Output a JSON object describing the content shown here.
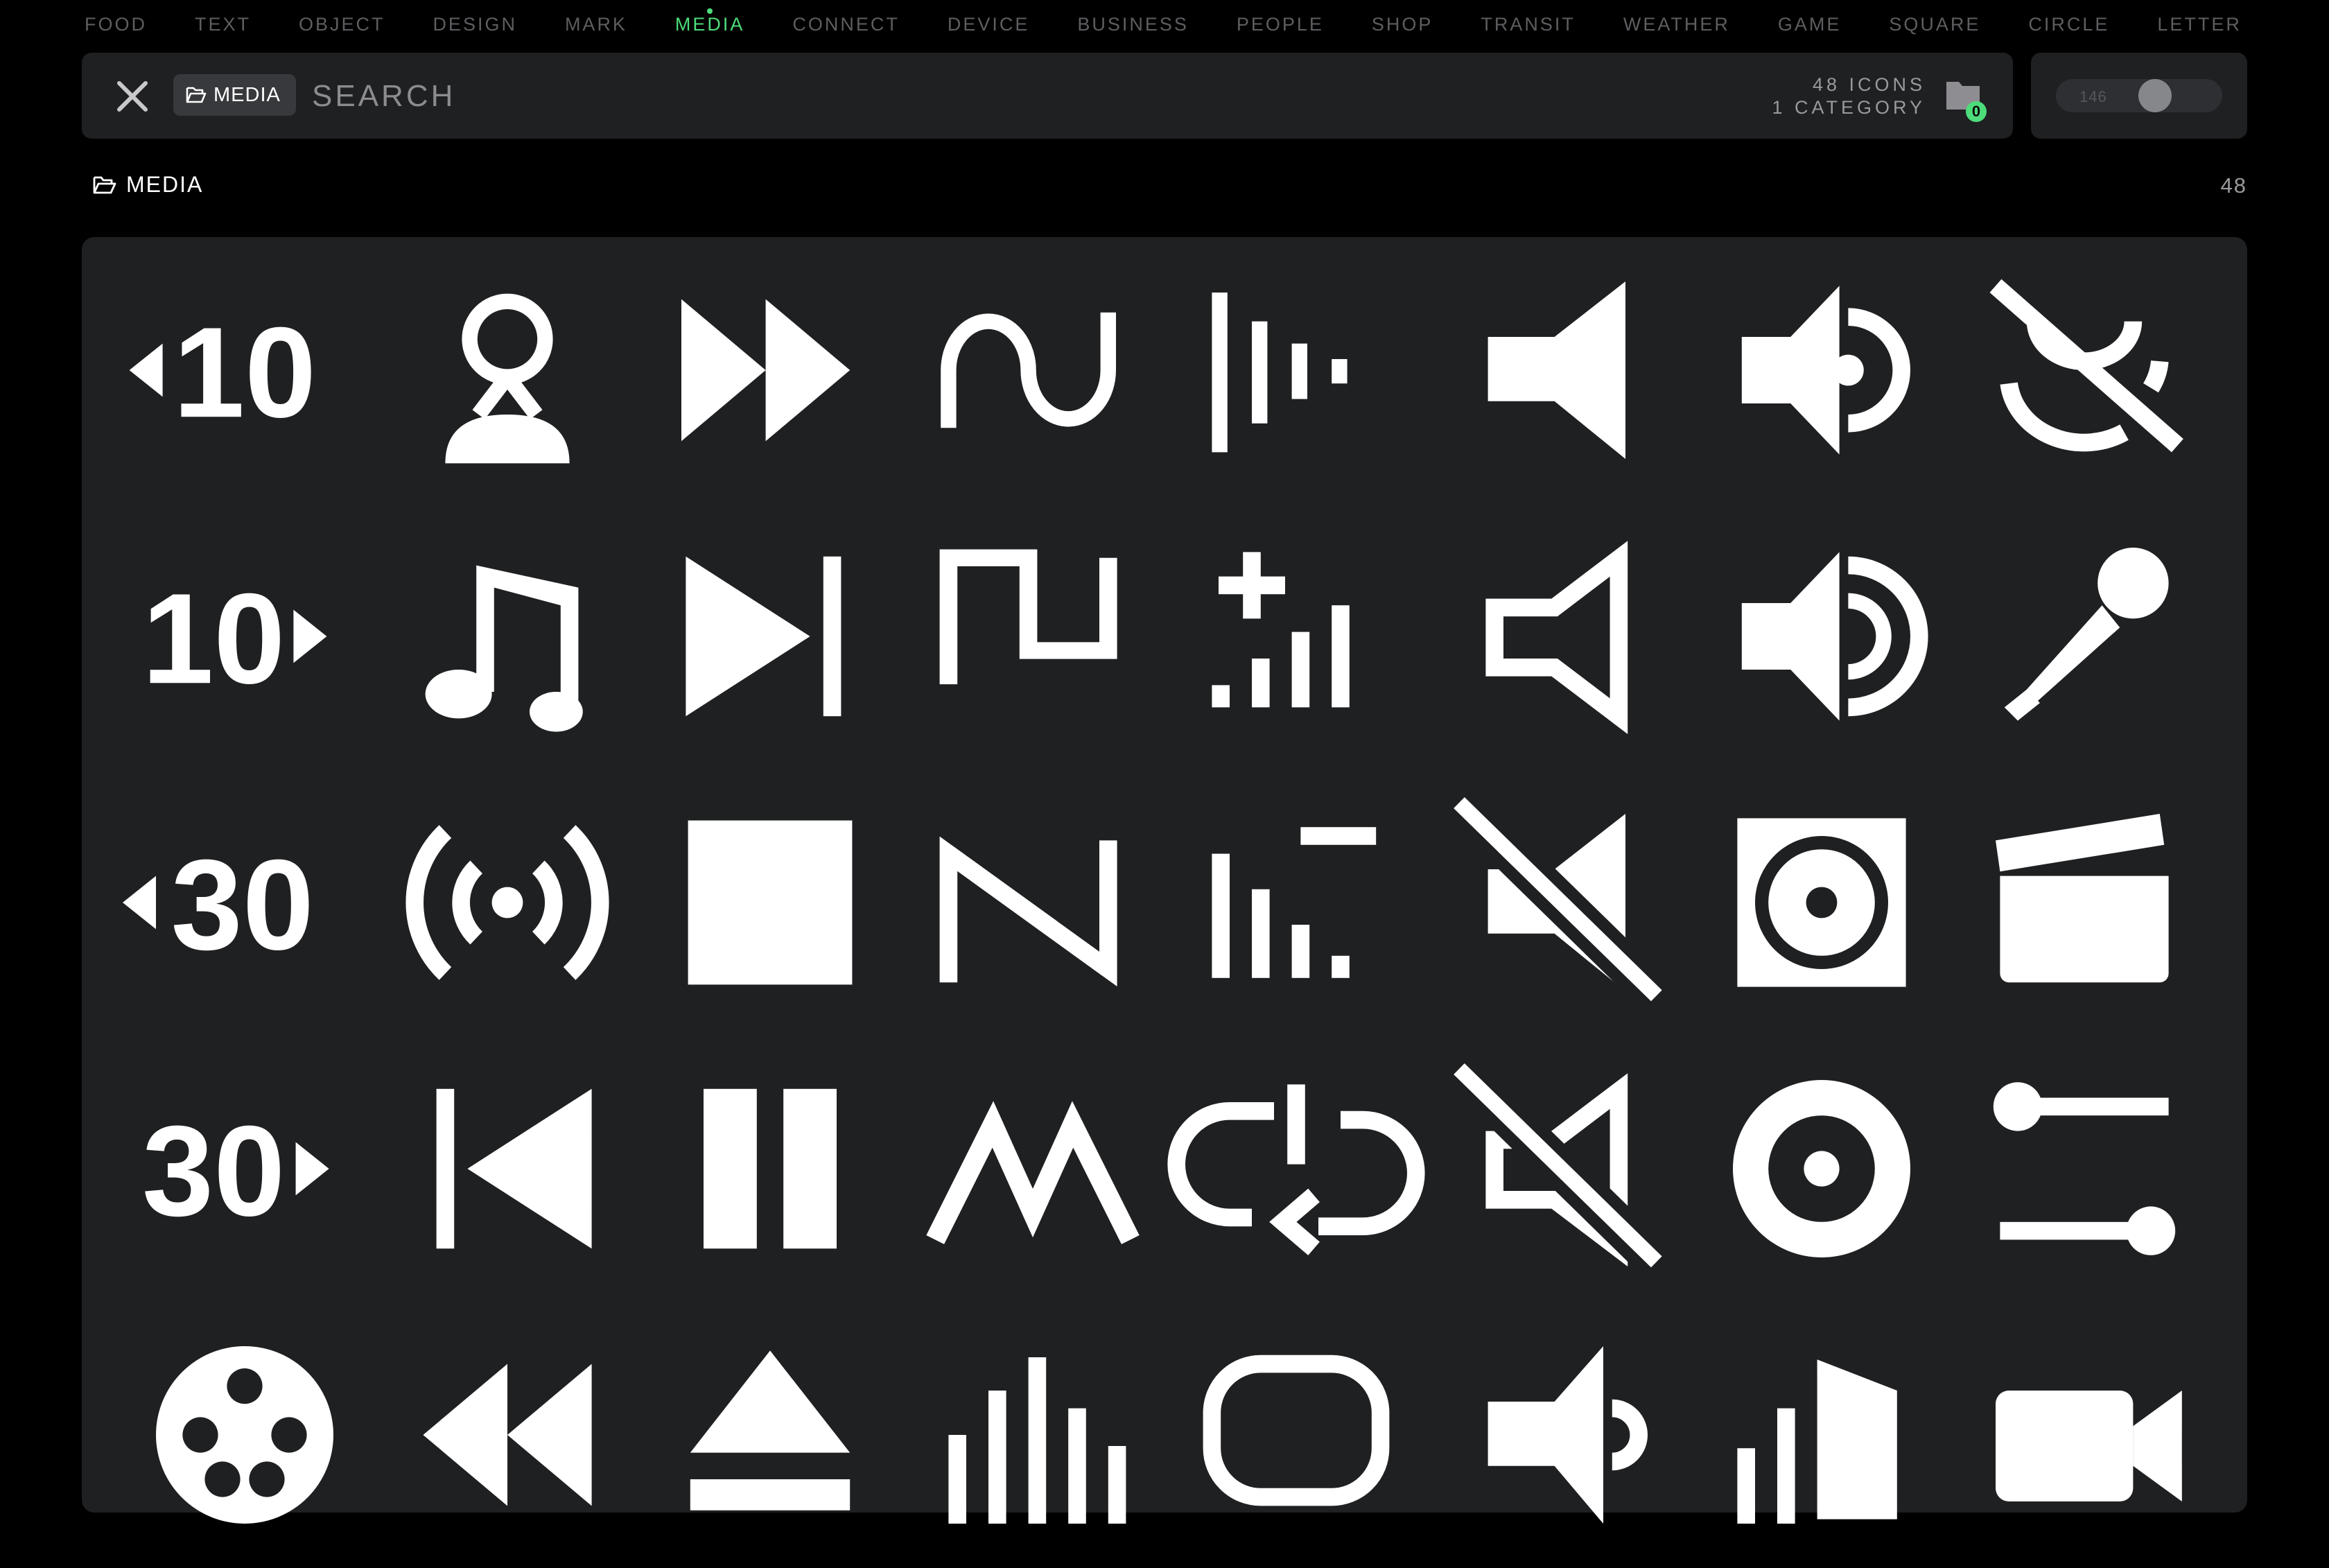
{
  "categories": [
    "FOOD",
    "TEXT",
    "OBJECT",
    "DESIGN",
    "MARK",
    "MEDIA",
    "CONNECT",
    "DEVICE",
    "BUSINESS",
    "PEOPLE",
    "SHOP",
    "TRANSIT",
    "WEATHER",
    "GAME",
    "SQUARE",
    "CIRCLE",
    "LETTER"
  ],
  "active_category_index": 5,
  "search": {
    "chip_label": "MEDIA",
    "placeholder": "SEARCH",
    "value": "",
    "icon_count": "48 ICONS",
    "category_count": "1 CATEGORY",
    "folder_badge": "0"
  },
  "size_slider": {
    "value_label": "146",
    "level": 0.62
  },
  "section": {
    "title": "MEDIA",
    "count": "48"
  },
  "colors": {
    "accent": "#4ddc7a",
    "panel": "#1f2022",
    "background": "#000000",
    "muted_text": "#5e5e62"
  },
  "icons": [
    {
      "name": "replay-10"
    },
    {
      "name": "podcaster"
    },
    {
      "name": "fast-forward"
    },
    {
      "name": "sine-wave"
    },
    {
      "name": "audio-wave"
    },
    {
      "name": "speaker"
    },
    {
      "name": "volume-up"
    },
    {
      "name": "microphone-off"
    },
    {
      "name": "forward-10"
    },
    {
      "name": "music-note"
    },
    {
      "name": "skip-next"
    },
    {
      "name": "square-wave"
    },
    {
      "name": "volume-add"
    },
    {
      "name": "speaker-outline"
    },
    {
      "name": "volume-max"
    },
    {
      "name": "microphone"
    },
    {
      "name": "replay-30"
    },
    {
      "name": "broadcast"
    },
    {
      "name": "stop"
    },
    {
      "name": "sawtooth-wave"
    },
    {
      "name": "volume-bars-minus"
    },
    {
      "name": "speaker-mute"
    },
    {
      "name": "disc-square"
    },
    {
      "name": "clapperboard"
    },
    {
      "name": "forward-30"
    },
    {
      "name": "skip-previous"
    },
    {
      "name": "pause"
    },
    {
      "name": "triangle-wave"
    },
    {
      "name": "repeat-one"
    },
    {
      "name": "speaker-outline-mute"
    },
    {
      "name": "disc"
    },
    {
      "name": "sliders"
    },
    {
      "name": "film-reel"
    },
    {
      "name": "rewind"
    },
    {
      "name": "eject"
    },
    {
      "name": "equalizer"
    },
    {
      "name": "repeat"
    },
    {
      "name": "volume-low"
    },
    {
      "name": "volume-bars-speaker"
    },
    {
      "name": "video-camera"
    }
  ]
}
